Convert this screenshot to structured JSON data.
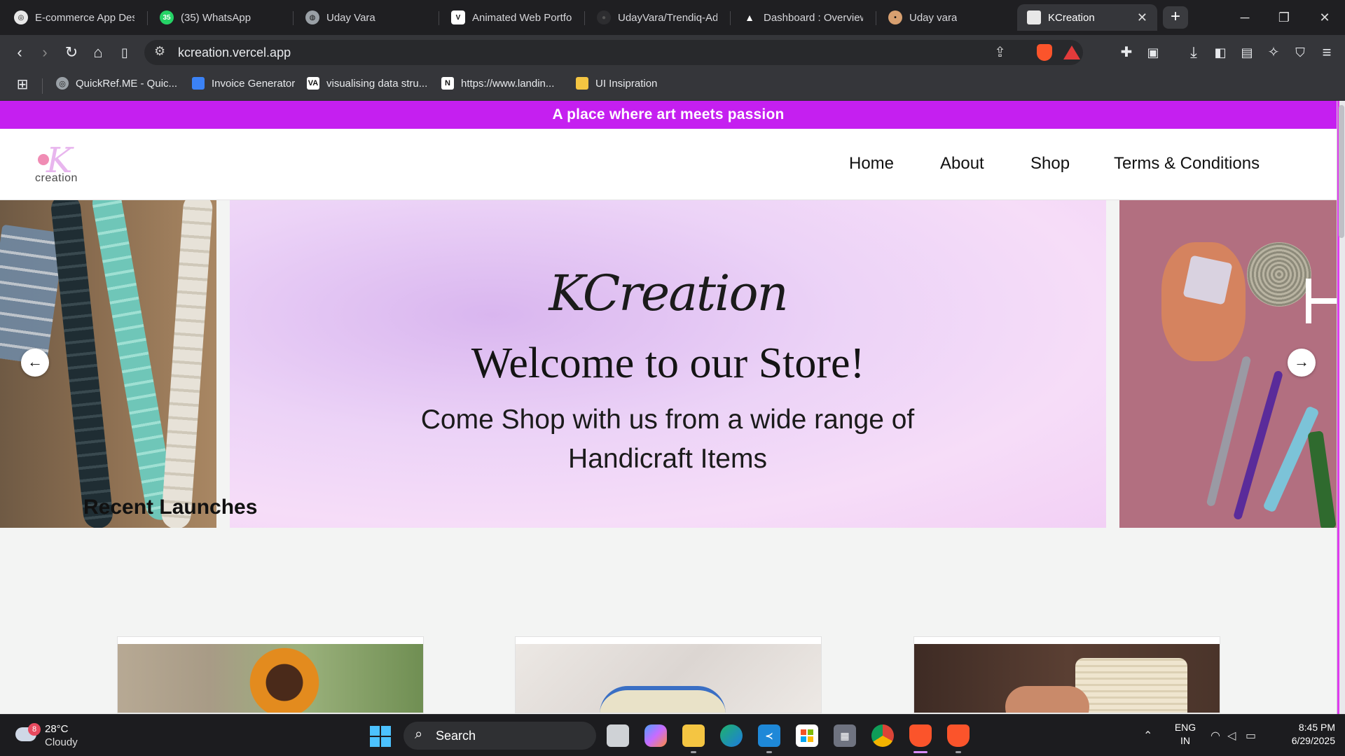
{
  "browser": {
    "tabs": [
      {
        "label": "E-commerce App Des",
        "icon": "openai-icon"
      },
      {
        "label": "(35) WhatsApp",
        "icon": "whatsapp-icon"
      },
      {
        "label": "Uday Vara",
        "icon": "globe-icon"
      },
      {
        "label": "Animated Web Portfo",
        "icon": "portfolio-icon"
      },
      {
        "label": "UdayVara/Trendiq-Ad",
        "icon": "github-icon"
      },
      {
        "label": "Dashboard : Overview",
        "icon": "vercel-icon"
      },
      {
        "label": "Uday vara",
        "icon": "profile-icon"
      },
      {
        "label": "KCreation",
        "icon": "page-icon",
        "active": true
      }
    ],
    "new_tab": "+",
    "url": "kcreation.vercel.app",
    "bookmarks": [
      {
        "label": "QuickRef.ME - Quic...",
        "icon": "quickref-icon"
      },
      {
        "label": "Invoice Generator",
        "icon": "invoice-icon"
      },
      {
        "label": "visualising data stru...",
        "icon": "visualising-icon"
      },
      {
        "label": "https://www.landin...",
        "icon": "notion-icon"
      },
      {
        "label": "UI Insipration",
        "icon": "folder-icon"
      }
    ]
  },
  "site": {
    "announcement": "A place where art meets passion",
    "logo_letter": "K",
    "logo_word": "creation",
    "nav": [
      "Home",
      "About",
      "Shop",
      "Terms & Conditions"
    ],
    "hero": {
      "script_title": "KCreation",
      "headline": "Welcome to our Store!",
      "subheadline": "Come Shop with us from a wide range of Handicraft Items",
      "prev_arrow": "←",
      "next_arrow": "→"
    },
    "recent_title": "Recent Launches"
  },
  "taskbar": {
    "weather_badge": "8",
    "temperature": "28°C",
    "condition": "Cloudy",
    "search_label": "Search",
    "lang_top": "ENG",
    "lang_bottom": "IN",
    "time": "8:45 PM",
    "date": "6/29/2025"
  },
  "colors": {
    "announcement_bg": "#c51ff0",
    "hero_bg": "#ecd3f7",
    "taskbar_bg": "#1c1c1f"
  }
}
